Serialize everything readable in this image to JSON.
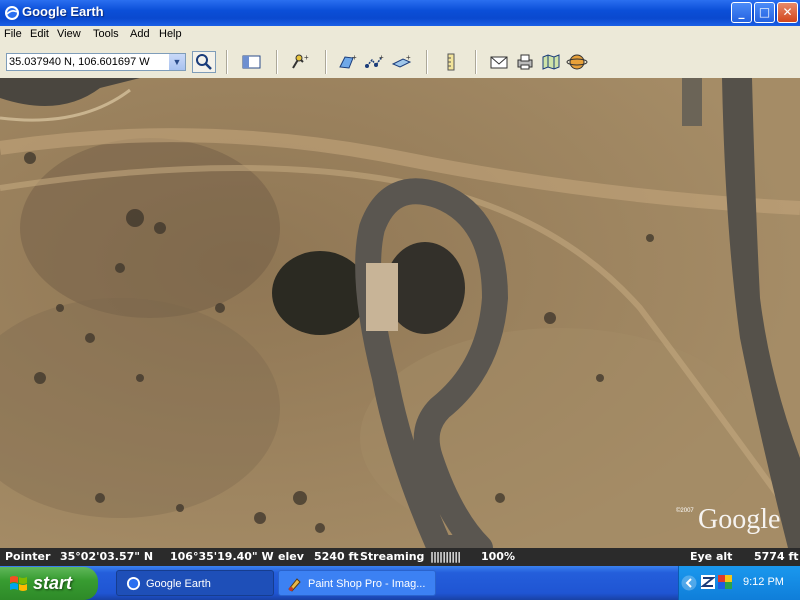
{
  "window": {
    "title": "Google Earth",
    "buttons": {
      "minimize": "_",
      "maximize": "□",
      "close": "✕"
    }
  },
  "menu": [
    "File",
    "Edit",
    "View",
    "Tools",
    "Add",
    "Help"
  ],
  "toolbar": {
    "search_value": "35.037940 N, 106.601697 W",
    "tools": [
      "sidebar-icon",
      "placemark-icon",
      "polygon-icon",
      "path-icon",
      "image-overlay-icon",
      "ruler-icon",
      "email-icon",
      "print-icon",
      "maps-icon",
      "sky-icon"
    ]
  },
  "map": {
    "watermark": "Google",
    "copyright": "©2007"
  },
  "status": {
    "pointer_label": "Pointer",
    "lat": "35°02'03.57\" N",
    "lon": "106°35'19.40\" W",
    "elev_label": "elev",
    "elev_value": "5240 ft",
    "streaming_label": "Streaming",
    "streaming_bar": "||||||||||",
    "streaming_pct": "100%",
    "eye_label": "Eye alt",
    "eye_value": "5774 ft"
  },
  "taskbar": {
    "start_label": "start",
    "tasks": [
      {
        "label": "Google Earth",
        "active": true
      },
      {
        "label": "Paint Shop Pro - Imag...",
        "active": false
      }
    ],
    "clock": "9:12 PM",
    "colors": {
      "start": "#3c9c35",
      "taskbar": "#245edb",
      "tray": "#0f7ed9"
    }
  }
}
